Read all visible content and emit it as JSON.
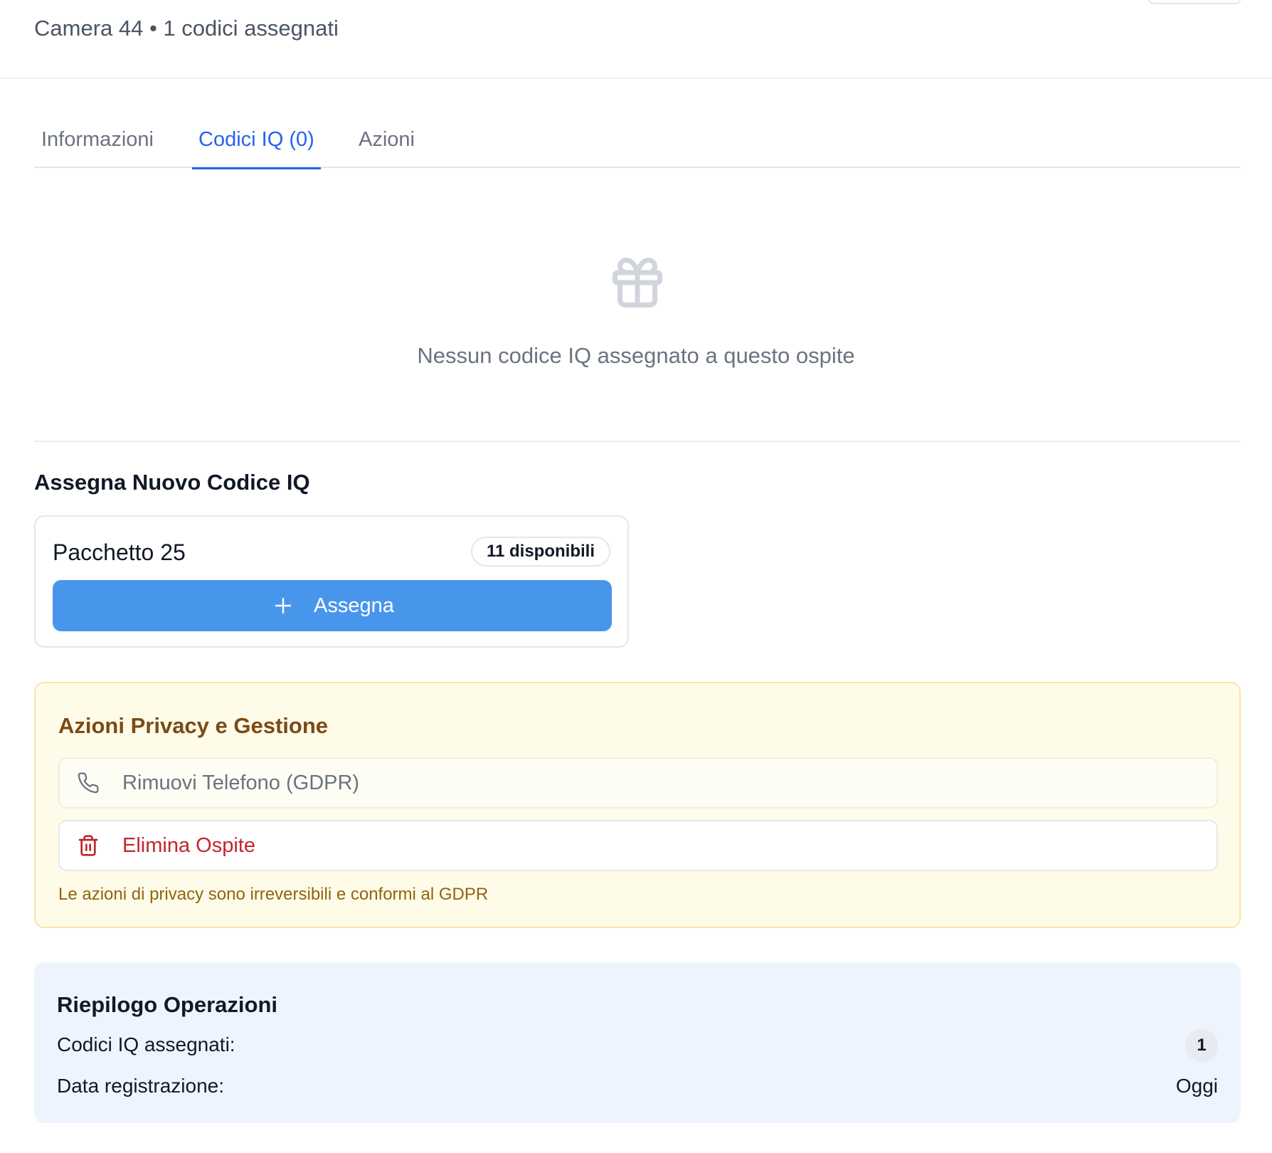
{
  "header": {
    "subtitle": "Camera 44 • 1 codici assegnati"
  },
  "tabs": [
    {
      "label": "Informazioni",
      "active": false
    },
    {
      "label": "Codici IQ (0)",
      "active": true
    },
    {
      "label": "Azioni",
      "active": false
    }
  ],
  "empty_state": {
    "icon": "gift-icon",
    "message": "Nessun codice IQ assegnato a questo ospite"
  },
  "assign_section": {
    "title": "Assegna Nuovo Codice IQ",
    "package": {
      "name": "Pacchetto 25",
      "availability": "11 disponibili",
      "button_icon": "plus-icon",
      "button_label": "Assegna"
    }
  },
  "privacy": {
    "title": "Azioni Privacy e Gestione",
    "actions": [
      {
        "icon": "phone-icon",
        "label": "Rimuovi Telefono (GDPR)"
      },
      {
        "icon": "trash-icon",
        "label": "Elimina Ospite"
      }
    ],
    "note": "Le azioni di privacy sono irreversibili e conformi al GDPR"
  },
  "summary": {
    "title": "Riepilogo Operazioni",
    "rows": [
      {
        "label": "Codici IQ assegnati:",
        "value": "1"
      },
      {
        "label": "Data registrazione:",
        "value": "Oggi"
      }
    ]
  },
  "colors": {
    "accent": "#2563eb",
    "button": "#4896ec",
    "privacy_bg": "#fefce9",
    "privacy_title": "#7c4a14",
    "danger": "#c0272d",
    "summary_bg": "#eef4fd"
  }
}
